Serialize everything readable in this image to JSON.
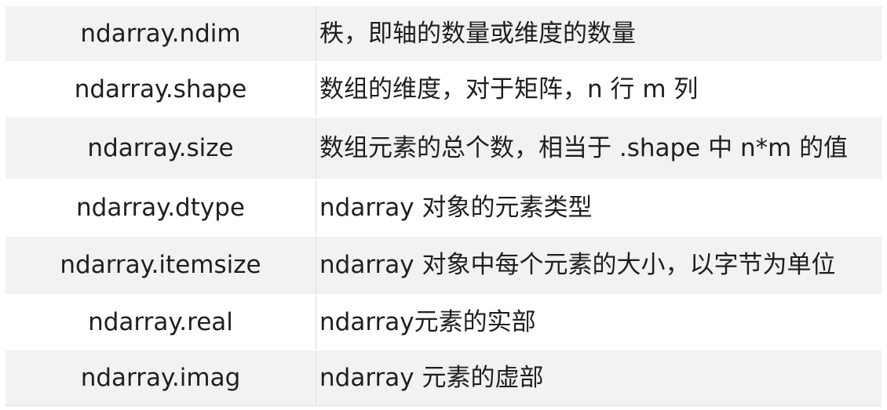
{
  "table": {
    "rows": [
      {
        "attribute": "ndarray.ndim",
        "description": "秩，即轴的数量或维度的数量"
      },
      {
        "attribute": "ndarray.shape",
        "description": "数组的维度，对于矩阵，n 行 m 列"
      },
      {
        "attribute": "ndarray.size",
        "description": "数组元素的总个数，相当于 .shape 中 n*m 的值"
      },
      {
        "attribute": "ndarray.dtype",
        "description": "ndarray 对象的元素类型"
      },
      {
        "attribute": "ndarray.itemsize",
        "description": "ndarray 对象中每个元素的大小，以字节为单位"
      },
      {
        "attribute": "ndarray.real",
        "description": "ndarray元素的实部"
      },
      {
        "attribute": "ndarray.imag",
        "description": "ndarray 元素的虚部"
      }
    ]
  },
  "colors": {
    "stripe": "#f2f2f2",
    "text": "#1f1f1f"
  }
}
